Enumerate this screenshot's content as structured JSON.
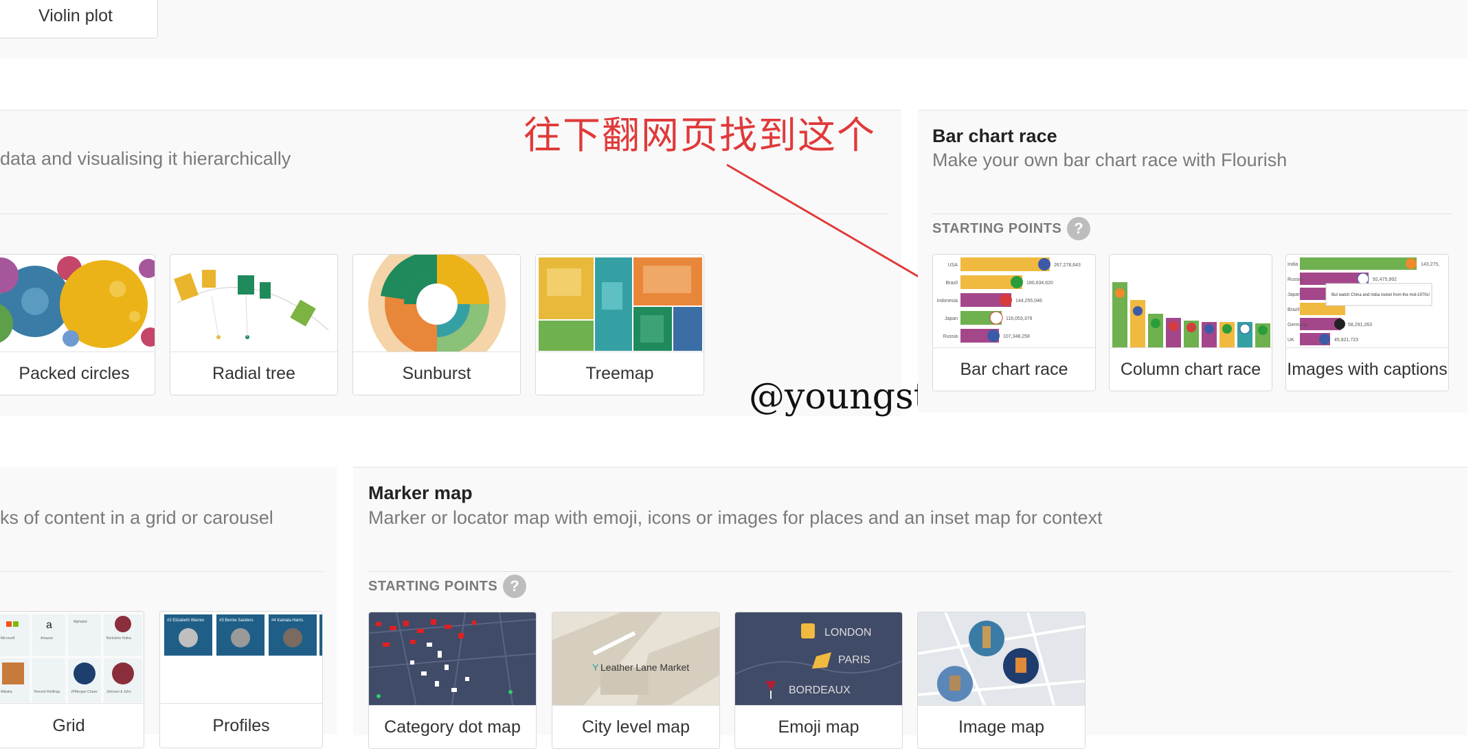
{
  "top_strip": {
    "violin_label": "Violin plot"
  },
  "hierarchy_section": {
    "subtitle": "data and visualising it hierarchically",
    "cards": [
      {
        "label": "Packed circles"
      },
      {
        "label": "Radial tree"
      },
      {
        "label": "Sunburst"
      },
      {
        "label": "Treemap"
      }
    ]
  },
  "annotation": {
    "text": "往下翻网页找到这个"
  },
  "watermark": {
    "text": "@youngstar"
  },
  "bar_chart_race_section": {
    "title": "Bar chart race",
    "subtitle": "Make your own bar chart race with Flourish",
    "starting_points": "STARTING POINTS",
    "help": "?",
    "cards": [
      {
        "label": "Bar chart race"
      },
      {
        "label": "Column chart race"
      },
      {
        "label": "Images with captions"
      }
    ],
    "bar_thumb": {
      "rows": [
        {
          "name": "USA",
          "value": "267,278,643"
        },
        {
          "name": "Brazil",
          "value": "180,634,620"
        },
        {
          "name": "Indonesia",
          "value": "144,255,046"
        },
        {
          "name": "Japan",
          "value": "116,053,379"
        },
        {
          "name": "Russia",
          "value": "107,348,258"
        }
      ]
    },
    "images_thumb": {
      "caption": "But watch China and India rocket from the mid-1970s!",
      "rows": [
        {
          "name": "India",
          "value": "143,275,"
        },
        {
          "name": "Russia",
          "value": "92,475,992"
        },
        {
          "name": "Japan",
          "value": ""
        },
        {
          "name": "Brazil",
          "value": ""
        },
        {
          "name": "Germany",
          "value": "58,291,263"
        },
        {
          "name": "UK",
          "value": "45,821,723"
        }
      ]
    }
  },
  "cards_section": {
    "subtitle": "ks of content in a grid or carousel",
    "cards": [
      {
        "label": "Grid"
      },
      {
        "label": "Profiles"
      }
    ],
    "grid_thumb": {
      "items": [
        "Microsoft",
        "Amazon",
        "Alphabet",
        "Berkshire Hatha",
        "Alibaba",
        "Tencent Holdings",
        "JPMorgan Chase",
        "Johnson & John"
      ]
    },
    "profiles_thumb": {
      "items": [
        "#2 Elizabeth Warren",
        "#3 Bernie Sanders",
        "#4 Kamala Harris"
      ]
    }
  },
  "marker_map_section": {
    "title": "Marker map",
    "subtitle": "Marker or locator map with emoji, icons or images for places and an inset map for context",
    "starting_points": "STARTING POINTS",
    "help": "?",
    "cards": [
      {
        "label": "Category dot map"
      },
      {
        "label": "City level map"
      },
      {
        "label": "Emoji map"
      },
      {
        "label": "Image map"
      }
    ],
    "city_thumb_label": "Leather Lane Market",
    "emoji_thumb_labels": [
      "LONDON",
      "PARIS",
      "BORDEAUX"
    ]
  },
  "colors": {
    "annotation": "#e03a3a",
    "band_bg": "#f9f9f9",
    "bar_yellow": "#f0b940",
    "bar_green": "#6fb04f",
    "bar_purple": "#a4478a",
    "map_dark": "#404b68"
  }
}
